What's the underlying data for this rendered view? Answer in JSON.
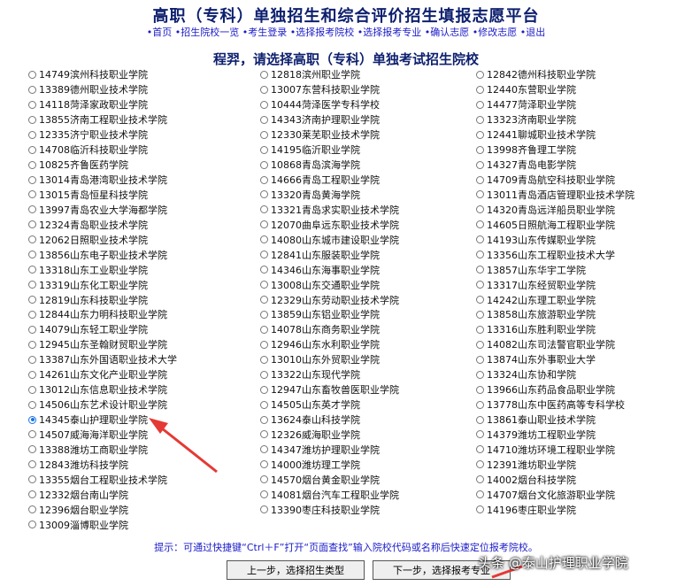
{
  "header": {
    "title": "高职（专科）单独招生和综合评价招生填报志愿平台"
  },
  "nav": {
    "items": [
      "首页",
      "招生院校一览",
      "考生登录",
      "选择报考院校",
      "选择报考专业",
      "确认志愿",
      "修改志愿",
      "退出"
    ]
  },
  "subtitle": "程羿，请选择高职（专科）单独考试招生院校",
  "schools": [
    [
      "14749滨州科技职业学院",
      "12818滨州职业学院",
      "12842德州科技职业学院"
    ],
    [
      "13389德州职业技术学院",
      "13007东营科技职业学院",
      "12440东营职业学院"
    ],
    [
      "14118菏泽家政职业学院",
      "10444菏泽医学专科学校",
      "14477菏泽职业学院"
    ],
    [
      "13855济南工程职业技术学院",
      "14343济南护理职业学院",
      "13323济南职业学院"
    ],
    [
      "12335济宁职业技术学院",
      "12330莱芜职业技术学院",
      "12441聊城职业技术学院"
    ],
    [
      "14708临沂科技职业学院",
      "14195临沂职业学院",
      "13998齐鲁理工学院"
    ],
    [
      "10825齐鲁医药学院",
      "10868青岛滨海学院",
      "14327青岛电影学院"
    ],
    [
      "13014青岛港湾职业技术学院",
      "14666青岛工程职业学院",
      "14709青岛航空科技职业学院"
    ],
    [
      "13015青岛恒星科技学院",
      "13320青岛黄海学院",
      "13011青岛酒店管理职业技术学院"
    ],
    [
      "13997青岛农业大学海都学院",
      "13321青岛求实职业技术学院",
      "14320青岛远洋船员职业学院"
    ],
    [
      "12324青岛职业技术学院",
      "12070曲阜远东职业技术学院",
      "14605日照航海工程职业学院"
    ],
    [
      "12062日照职业技术学院",
      "14080山东城市建设职业学院",
      "14193山东传媒职业学院"
    ],
    [
      "13856山东电子职业技术学院",
      "12841山东服装职业学院",
      "13356山东工程职业技术大学"
    ],
    [
      "13318山东工业职业学院",
      "14346山东海事职业学院",
      "13857山东华宇工学院"
    ],
    [
      "13319山东化工职业学院",
      "13008山东交通职业学院",
      "13317山东经贸职业学院"
    ],
    [
      "12819山东科技职业学院",
      "12329山东劳动职业技术学院",
      "14242山东理工职业学院"
    ],
    [
      "12844山东力明科技职业学院",
      "13859山东铝业职业学院",
      "13858山东旅游职业学院"
    ],
    [
      "14079山东轻工职业学院",
      "14078山东商务职业学院",
      "13316山东胜利职业学院"
    ],
    [
      "12945山东圣翰财贸职业学院",
      "12946山东水利职业学院",
      "14082山东司法警官职业学院"
    ],
    [
      "13387山东外国语职业技术大学",
      "13010山东外贸职业学院",
      "13874山东外事职业大学"
    ],
    [
      "14261山东文化产业职业学院",
      "13322山东现代学院",
      "13324山东协和学院"
    ],
    [
      "13012山东信息职业技术学院",
      "12947山东畜牧兽医职业学院",
      "13966山东药品食品职业学院"
    ],
    [
      "14506山东艺术设计职业学院",
      "14505山东英才学院",
      "13778山东中医药高等专科学校"
    ],
    [
      "14345泰山护理职业学院",
      "13624泰山科技学院",
      "13861泰山职业技术学院"
    ],
    [
      "14507威海海洋职业学院",
      "12326威海职业学院",
      "14379潍坊工程职业学院"
    ],
    [
      "13388潍坊工商职业学院",
      "14347潍坊护理职业学院",
      "14710潍坊环境工程职业学院"
    ],
    [
      "12843潍坊科技学院",
      "14000潍坊理工学院",
      "12391潍坊职业学院"
    ],
    [
      "13355烟台工程职业技术学院",
      "14570烟台黄金职业学院",
      "14002烟台科技学院"
    ],
    [
      "12332烟台南山学院",
      "14081烟台汽车工程职业学院",
      "14707烟台文化旅游职业学院"
    ],
    [
      "12396烟台职业学院",
      "13390枣庄科技职业学院",
      "14196枣庄职业学院"
    ],
    [
      "13009淄博职业学院",
      "",
      ""
    ]
  ],
  "selected": "14345泰山护理职业学院",
  "tip": "提示：可通过快捷键“Ctrl＋F”打开“页面查找”输入院校代码或名称后快速定位报考院校。",
  "buttons": {
    "prev": "上一步，选择招生类型",
    "next": "下一步，选择报考专业"
  },
  "watermark": "头条 @泰山护理职业学院",
  "colors": {
    "title": "#0d1f6e",
    "link": "#1b1bc8",
    "arrow": "#e53935",
    "radio_selected": "#1a73e8"
  }
}
